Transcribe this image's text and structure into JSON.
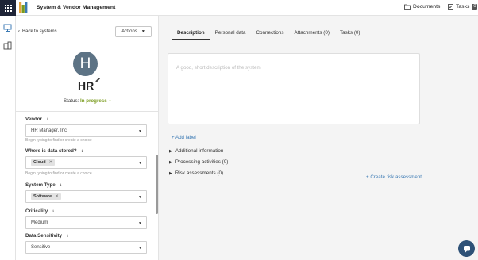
{
  "header": {
    "app_title": "System & Vendor Management",
    "documents_label": "Documents",
    "tasks_label": "Tasks",
    "tasks_count": "0"
  },
  "panel": {
    "back_label": "Back to systems",
    "actions_label": "Actions",
    "avatar_initial": "H",
    "system_name": "HR",
    "status_label": "Status:",
    "status_value": "In progress",
    "status_color": "#7a9b1e"
  },
  "fields": {
    "vendor": {
      "label": "Vendor",
      "value": "HR Manager, Inc",
      "hint": "Begin typing to find or create a choice"
    },
    "data_stored": {
      "label": "Where is data stored?",
      "chip": "Cloud",
      "hint": "Begin typing to find or create a choice"
    },
    "system_type": {
      "label": "System Type",
      "chip": "Software"
    },
    "criticality": {
      "label": "Criticality",
      "value": "Medium"
    },
    "data_sensitivity": {
      "label": "Data Sensitivity",
      "value": "Sensitive"
    }
  },
  "tabs": [
    {
      "label": "Description"
    },
    {
      "label": "Personal data"
    },
    {
      "label": "Connections"
    },
    {
      "label": "Attachments (0)"
    },
    {
      "label": "Tasks (0)"
    }
  ],
  "main": {
    "description_placeholder": "A good, short description of the system",
    "add_label": "+ Add label",
    "sections": [
      {
        "label": "Additional information"
      },
      {
        "label": "Processing activities (0)"
      },
      {
        "label": "Risk assessments (0)"
      }
    ],
    "create_risk_label": "+ Create risk assessment"
  },
  "colors": {
    "brand_dark": "#1f2538",
    "link_blue": "#3b7ab4",
    "avatar_bg": "#5d7385",
    "chat_bg": "#2e5177"
  },
  "icons": [
    "apps-grid-icon",
    "logo-icon",
    "folder-icon",
    "tasks-icon",
    "systems-icon",
    "vendors-icon",
    "chevron-left-icon",
    "caret-down-icon",
    "edit-icon",
    "info-icon",
    "chat-icon"
  ]
}
